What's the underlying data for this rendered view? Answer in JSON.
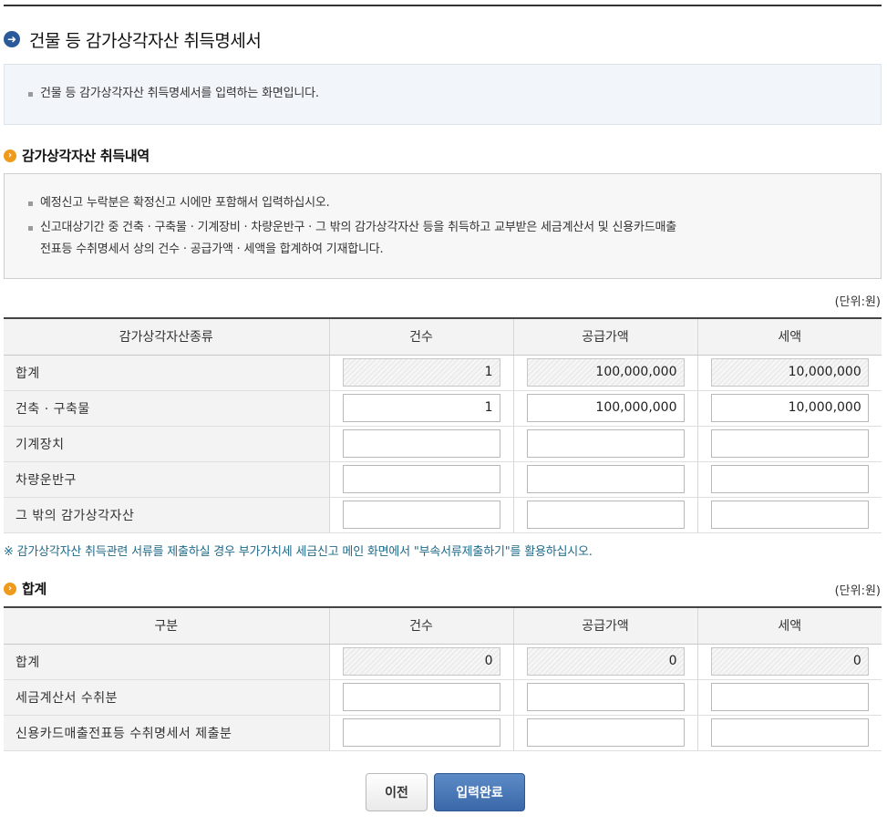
{
  "page": {
    "title": "건물 등 감가상각자산 취득명세서",
    "intro": "건물 등 감가상각자산 취득명세서를 입력하는 화면입니다."
  },
  "acquisition": {
    "section_title": "감가상각자산 취득내역",
    "notes": [
      "예정신고 누락분은 확정신고 시에만 포함해서 입력하십시오.",
      "신고대상기간 중 건축 · 구축물 · 기계장비 · 차량운반구 · 그 밖의 감가상각자산 등을 취득하고 교부받은 세금계산서 및 신용카드매출",
      "전표등 수취명세서 상의 건수 · 공급가액 · 세액을 합계하여 기재합니다."
    ],
    "unit": "(단위:원)",
    "headers": [
      "감가상각자산종류",
      "건수",
      "공급가액",
      "세액"
    ],
    "rows": [
      {
        "label": "합계",
        "count": "1",
        "supply": "100,000,000",
        "tax": "10,000,000",
        "readonly": true
      },
      {
        "label": "건축 · 구축물",
        "count": "1",
        "supply": "100,000,000",
        "tax": "10,000,000",
        "readonly": false
      },
      {
        "label": "기계장치",
        "count": "",
        "supply": "",
        "tax": "",
        "readonly": false
      },
      {
        "label": "차량운반구",
        "count": "",
        "supply": "",
        "tax": "",
        "readonly": false
      },
      {
        "label": "그 밖의 감가상각자산",
        "count": "",
        "supply": "",
        "tax": "",
        "readonly": false
      }
    ],
    "reference_note": "※ 감가상각자산 취득관련 서류를 제출하실 경우 부가가치세 세금신고 메인 화면에서 \"부속서류제출하기\"를 활용하십시오."
  },
  "summary": {
    "section_title": "합계",
    "unit": "(단위:원)",
    "headers": [
      "구분",
      "건수",
      "공급가액",
      "세액"
    ],
    "rows": [
      {
        "label": "합계",
        "count": "0",
        "supply": "0",
        "tax": "0",
        "readonly": true
      },
      {
        "label": "세금계산서 수취분",
        "count": "",
        "supply": "",
        "tax": "",
        "readonly": false
      },
      {
        "label": "신용카드매출전표등 수취명세서 제출분",
        "count": "",
        "supply": "",
        "tax": "",
        "readonly": false
      }
    ]
  },
  "buttons": {
    "prev": "이전",
    "done": "입력완료"
  },
  "colors": {
    "title_icon": "#2a5a9a",
    "section_icon": "#ef9a1b",
    "primary_button": "#3a68a8",
    "note_text": "#1e6a8a"
  },
  "icons": {
    "title": "arrow-circle-icon",
    "section": "chevron-circle-icon"
  }
}
